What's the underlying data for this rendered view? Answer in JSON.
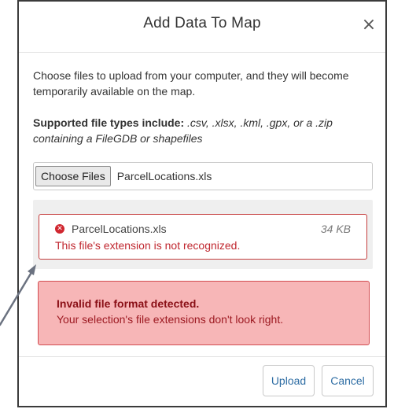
{
  "dialog": {
    "title": "Add Data To Map",
    "close_glyph": "×",
    "intro_text": "Choose files to upload from your computer, and they will become temporarily available on the map.",
    "supported_label": "Supported file types include:",
    "supported_types": " .csv, .xlsx, .kml, .gpx, or a .zip containing a FileGDB or shapefiles"
  },
  "file_input": {
    "button_label": "Choose Files",
    "selected_file": "ParcelLocations.xls"
  },
  "file_card": {
    "icon": "error-x-icon",
    "name": "ParcelLocations.xls",
    "size": "34 KB",
    "error_message": "This file's extension is not recognized."
  },
  "alert": {
    "title": "Invalid file format detected.",
    "body": "Your selection's file extensions don't look right."
  },
  "footer": {
    "upload_label": "Upload",
    "cancel_label": "Cancel"
  },
  "colors": {
    "error_red": "#c0272f",
    "alert_background": "#f7b6b7",
    "link_blue": "#2e6da4",
    "dialog_border": "#3b3b3b"
  }
}
